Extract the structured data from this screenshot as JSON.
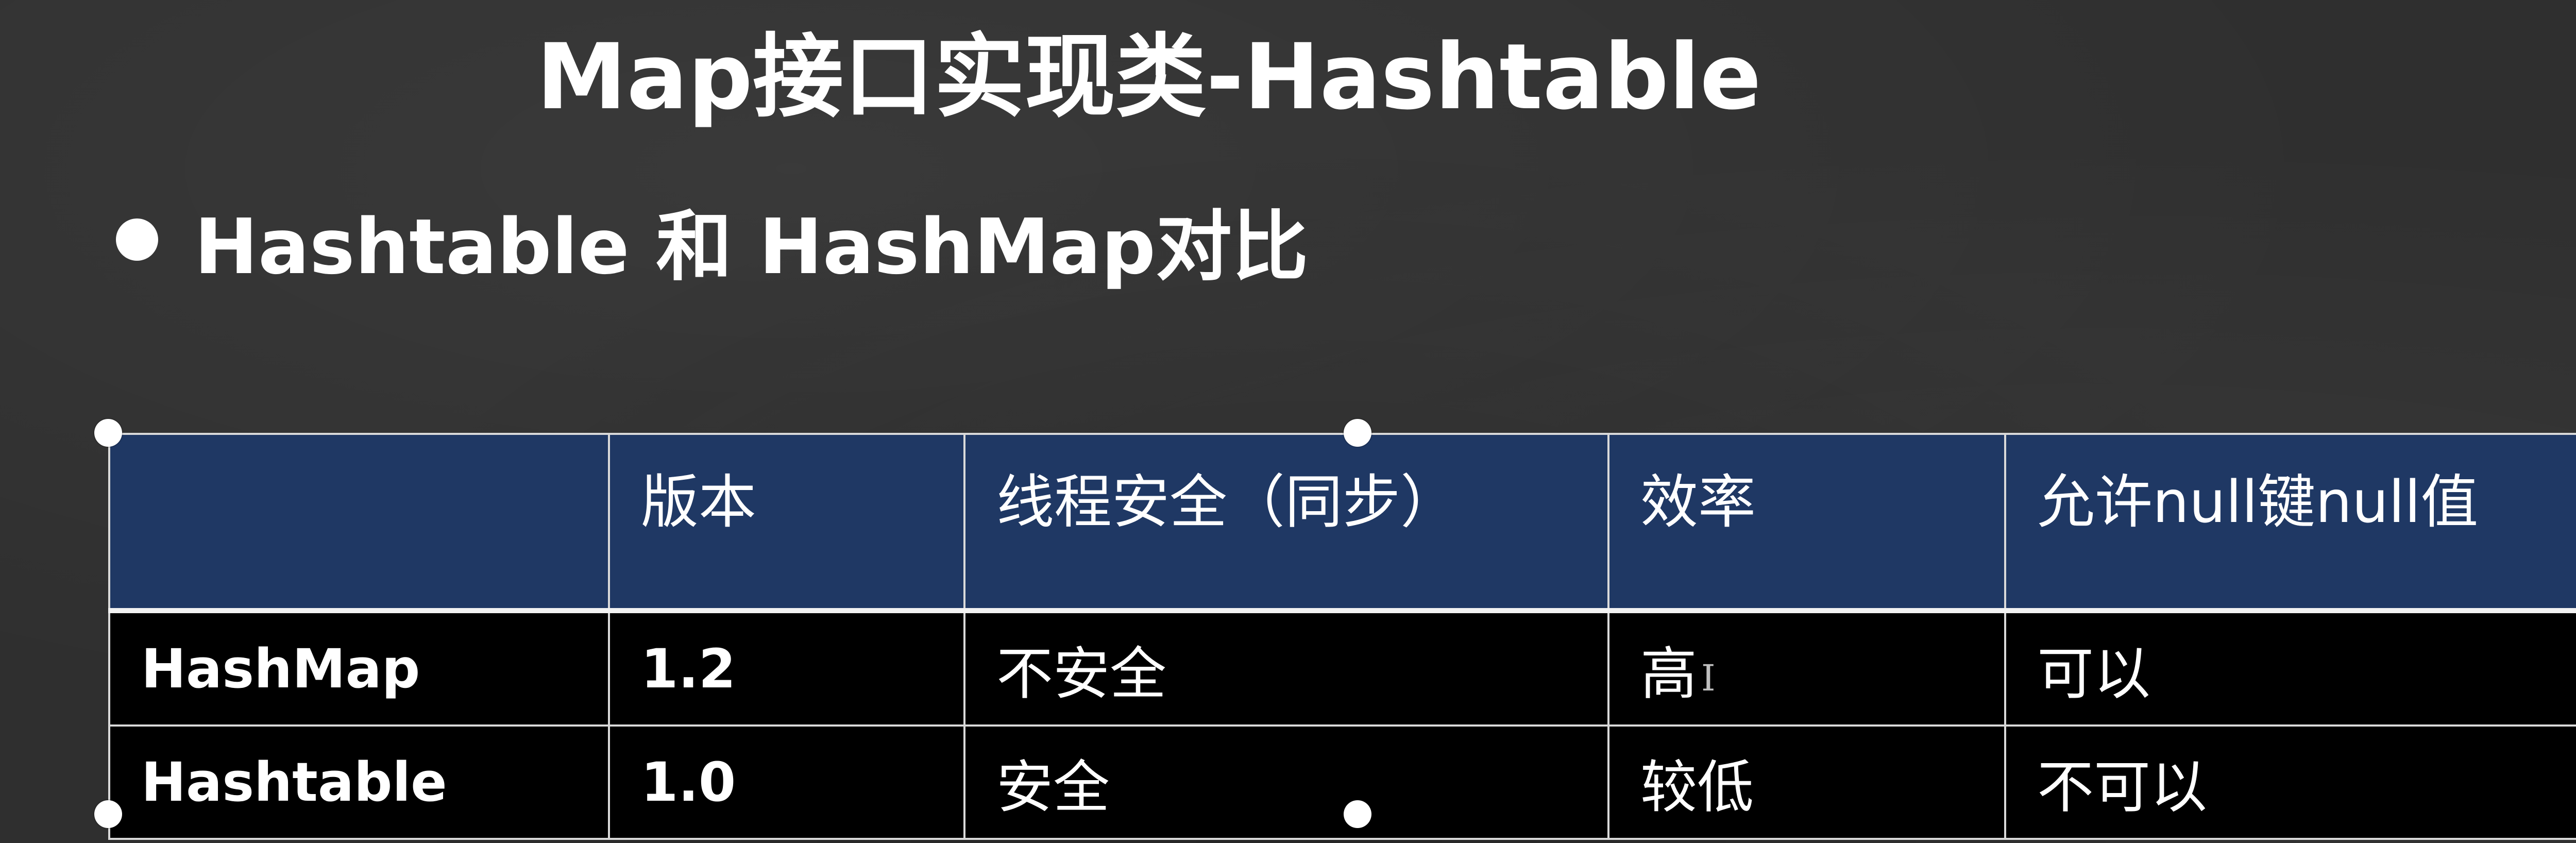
{
  "slide": {
    "title": "Map接口实现类-Hashtable",
    "bullet": "Hashtable 和 HashMap对比"
  },
  "table": {
    "headers": [
      "",
      "版本",
      "线程安全（同步）",
      "效率",
      "允许null键null值"
    ],
    "rows": [
      [
        "HashMap",
        "1.2",
        "不安全",
        "高",
        "可以"
      ],
      [
        "Hashtable",
        "1.0",
        "安全",
        "较低",
        "不可以"
      ]
    ]
  },
  "colors": {
    "background": "#2f2f2f",
    "header_fill": "#1f3864",
    "body_fill": "#000000",
    "text": "#ffffff"
  }
}
